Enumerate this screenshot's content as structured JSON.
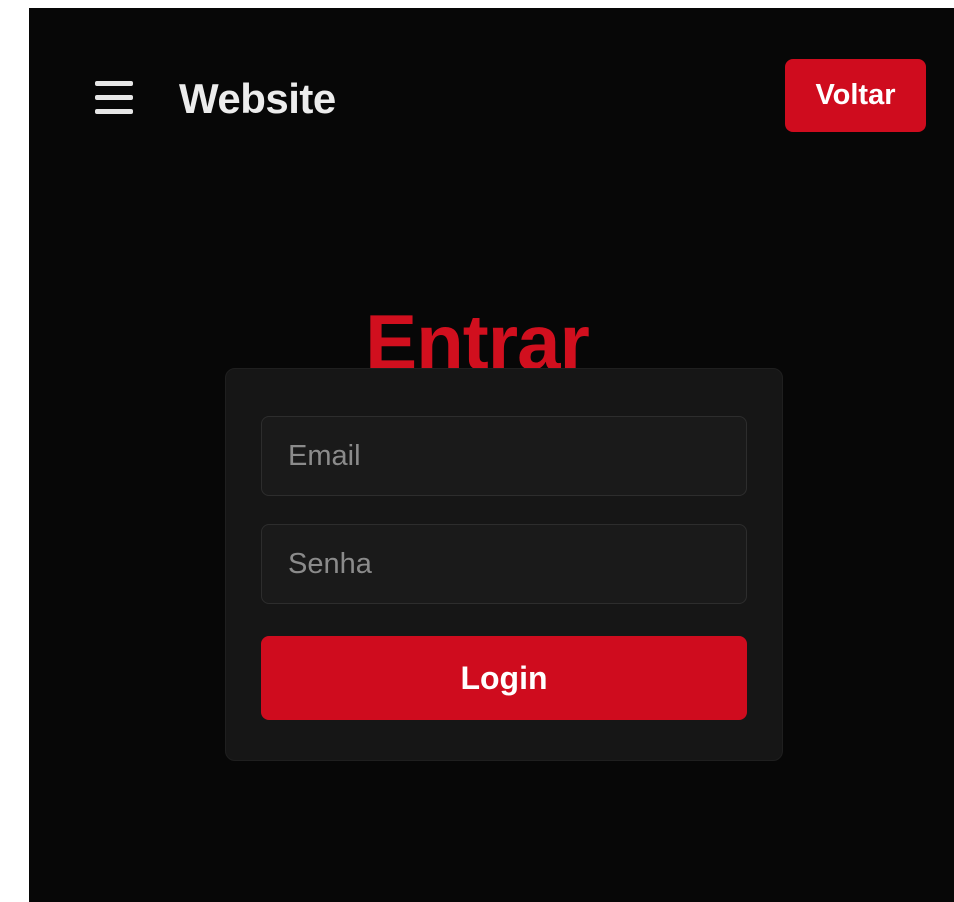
{
  "header": {
    "brand": "Website",
    "menu_icon": "hamburger-menu-icon",
    "back_label": "Voltar"
  },
  "main": {
    "title": "Entrar",
    "email": {
      "placeholder": "Email",
      "value": ""
    },
    "password": {
      "placeholder": "Senha",
      "value": ""
    },
    "login_label": "Login"
  },
  "colors": {
    "background": "#070707",
    "card": "#161616",
    "accent": "#cf0c1e",
    "title": "#d10f1e",
    "text": "#ececec",
    "placeholder": "#8b8b8b"
  }
}
